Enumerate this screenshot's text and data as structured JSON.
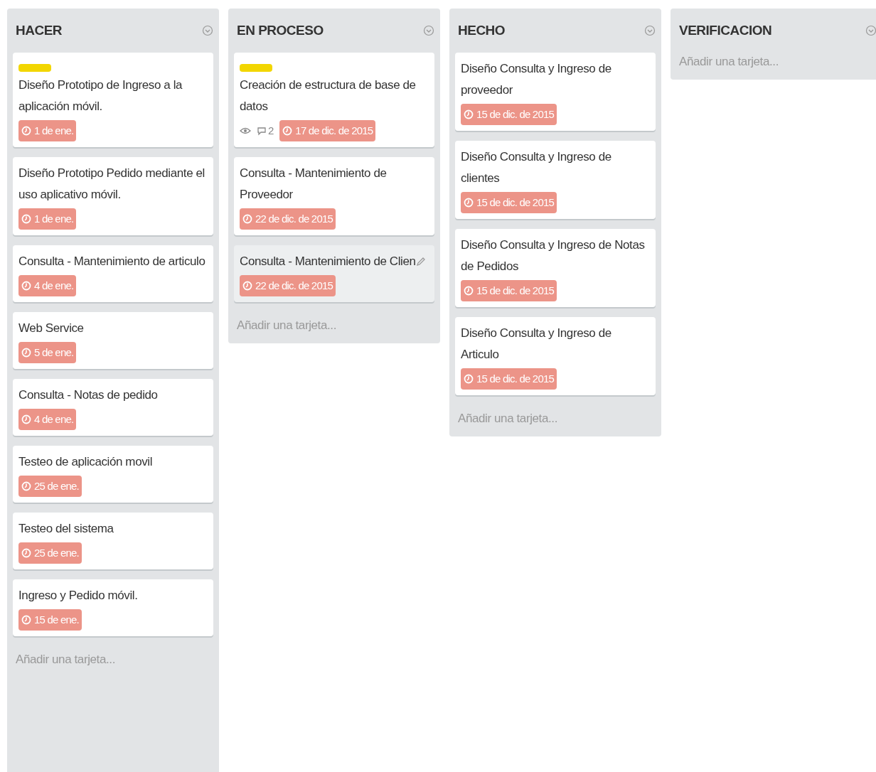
{
  "lists": [
    {
      "title": "HACER",
      "add_card": "Añadir una tarjeta...",
      "cards": [
        {
          "color": "#f2d600",
          "title": "Diseño Prototipo de Ingreso a la aplicación móvil.",
          "due": "1 de ene.",
          "hovered": false
        },
        {
          "title": "Diseño Prototipo Pedido mediante el uso aplicativo móvil.",
          "due": "1 de ene.",
          "hovered": false
        },
        {
          "title": "Consulta - Mantenimiento de articulo",
          "due": "4 de ene.",
          "hovered": false
        },
        {
          "title": "Web Service",
          "due": "5 de ene.",
          "hovered": false
        },
        {
          "title": "Consulta - Notas de pedido",
          "due": "4 de ene.",
          "hovered": false
        },
        {
          "title": "Testeo de aplicación movil",
          "due": "25 de ene.",
          "hovered": false
        },
        {
          "title": "Testeo del sistema",
          "due": "25 de ene.",
          "hovered": false
        },
        {
          "title": "Ingreso y Pedido móvil.",
          "due": "15 de ene.",
          "hovered": false
        }
      ]
    },
    {
      "title": "EN PROCESO",
      "add_card": "Añadir una tarjeta...",
      "cards": [
        {
          "color": "#f2d600",
          "title": "Creación de estructura de base de datos",
          "watching": true,
          "comments": "2",
          "due": "17 de dic. de 2015",
          "hovered": false
        },
        {
          "title": "Consulta - Mantenimiento de Proveedor",
          "due": "22 de dic. de 2015",
          "hovered": false
        },
        {
          "title": "Consulta - Mantenimiento de Clien",
          "due": "22 de dic. de 2015",
          "hovered": true
        }
      ]
    },
    {
      "title": "HECHO",
      "add_card": "Añadir una tarjeta...",
      "cards": [
        {
          "title": "Diseño Consulta y Ingreso de proveedor",
          "due": "15 de dic. de 2015",
          "hovered": false
        },
        {
          "title": "Diseño Consulta y Ingreso de clientes",
          "due": "15 de dic. de 2015",
          "hovered": false
        },
        {
          "title": "Diseño Consulta y Ingreso de Notas de Pedidos",
          "due": "15 de dic. de 2015",
          "hovered": false
        },
        {
          "title": "Diseño Consulta y Ingreso de Articulo",
          "due": "15 de dic. de 2015",
          "hovered": false
        }
      ]
    },
    {
      "title": "VERIFICACION",
      "add_card": "Añadir una tarjeta..."
    }
  ]
}
